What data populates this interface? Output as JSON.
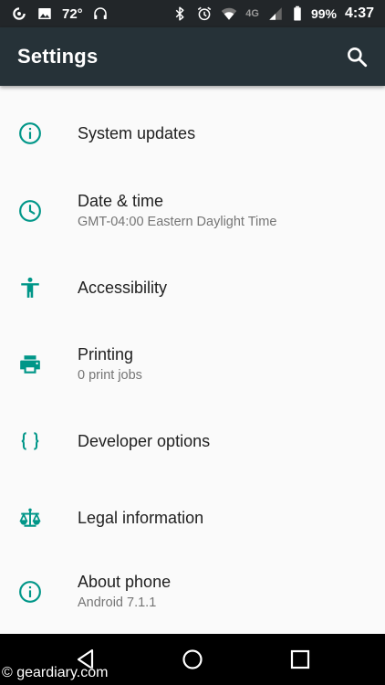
{
  "status_bar": {
    "temperature": "72°",
    "signal_label": "4G",
    "battery": "99%",
    "time": "4:37",
    "icons": [
      "swirl-notification-icon",
      "image-icon",
      "headset-icon",
      "bluetooth-icon",
      "alarm-icon",
      "wifi-icon",
      "cell-signal-icon",
      "battery-icon"
    ]
  },
  "app_bar": {
    "title": "Settings",
    "search_icon": "search-icon"
  },
  "colors": {
    "accent": "#009688",
    "app_bar": "#263238",
    "status_bar": "#222629",
    "background": "#fafafa"
  },
  "settings": [
    {
      "title": "System updates",
      "summary": "",
      "icon": "info-icon"
    },
    {
      "title": "Date & time",
      "summary": "GMT-04:00 Eastern Daylight Time",
      "icon": "clock-icon"
    },
    {
      "title": "Accessibility",
      "summary": "",
      "icon": "accessibility-icon"
    },
    {
      "title": "Printing",
      "summary": "0 print jobs",
      "icon": "printer-icon"
    },
    {
      "title": "Developer options",
      "summary": "",
      "icon": "code-braces-icon"
    },
    {
      "title": "Legal information",
      "summary": "",
      "icon": "scales-icon"
    },
    {
      "title": "About phone",
      "summary": "Android 7.1.1",
      "icon": "info-icon"
    }
  ],
  "nav_bar": {
    "icons": [
      "back-icon",
      "home-icon",
      "recents-icon"
    ]
  },
  "watermark": "© geardiary.com"
}
